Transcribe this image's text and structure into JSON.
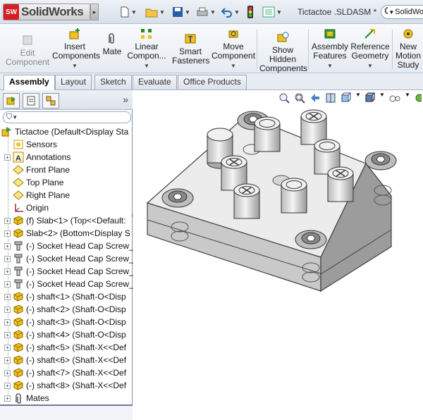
{
  "app": {
    "logo_text": "SolidWorks",
    "logo_badge": "SW",
    "doc_title": "Tictactoe .SLDASM *",
    "search_text": "SolidWo"
  },
  "commands": [
    {
      "label": "Edit Component",
      "disabled": true
    },
    {
      "label": "Insert Components"
    },
    {
      "label": "Mate"
    },
    {
      "label": "Linear Compon..."
    },
    {
      "label": "Smart Fasteners"
    },
    {
      "label": "Move Component"
    },
    {
      "label": "Show Hidden Components"
    },
    {
      "label": "Assembly Features"
    },
    {
      "label": "Reference Geometry"
    },
    {
      "label": "New Motion Study"
    }
  ],
  "tabs": [
    "Assembly",
    "Layout",
    "Sketch",
    "Evaluate",
    "Office Products"
  ],
  "tree": {
    "root": "Tictactoe  (Default<Display Sta",
    "items": [
      {
        "label": "Sensors",
        "icon": "sensor-icon",
        "expandable": false
      },
      {
        "label": "Annotations",
        "icon": "annotation-icon",
        "expandable": true
      },
      {
        "label": "Front Plane",
        "icon": "plane-icon",
        "expandable": false
      },
      {
        "label": "Top Plane",
        "icon": "plane-icon",
        "expandable": false
      },
      {
        "label": "Right Plane",
        "icon": "plane-icon",
        "expandable": false
      },
      {
        "label": "Origin",
        "icon": "origin-icon",
        "expandable": false
      },
      {
        "label": "(f) Slab<1> (Top<<Default:",
        "icon": "part-icon",
        "expandable": true
      },
      {
        "label": "Slab<2> (Bottom<Display S",
        "icon": "part-icon",
        "expandable": true
      },
      {
        "label": "(-) Socket Head Cap Screw_",
        "icon": "screw-icon",
        "expandable": true
      },
      {
        "label": "(-) Socket Head Cap Screw_",
        "icon": "screw-icon",
        "expandable": true
      },
      {
        "label": "(-) Socket Head Cap Screw_",
        "icon": "screw-icon",
        "expandable": true
      },
      {
        "label": "(-) Socket Head Cap Screw_",
        "icon": "screw-icon",
        "expandable": true
      },
      {
        "label": "(-) shaft<1> (Shaft-O<Disp",
        "icon": "part-icon",
        "expandable": true
      },
      {
        "label": "(-) shaft<2> (Shaft-O<Disp",
        "icon": "part-icon",
        "expandable": true
      },
      {
        "label": "(-) shaft<3> (Shaft-O<Disp",
        "icon": "part-icon",
        "expandable": true
      },
      {
        "label": "(-) shaft<4> (Shaft-O<Disp",
        "icon": "part-icon",
        "expandable": true
      },
      {
        "label": "(-) shaft<5> (Shaft-X<<Def",
        "icon": "part-icon",
        "expandable": true
      },
      {
        "label": "(-) shaft<6> (Shaft-X<<Def",
        "icon": "part-icon",
        "expandable": true
      },
      {
        "label": "(-) shaft<7> (Shaft-X<<Def",
        "icon": "part-icon",
        "expandable": true
      },
      {
        "label": "(-) shaft<8> (Shaft-X<<Def",
        "icon": "part-icon",
        "expandable": true
      },
      {
        "label": "Mates",
        "icon": "mates-icon",
        "expandable": true
      }
    ]
  },
  "colors": {
    "accent": "#d31f25",
    "part_yellow": "#f2c21b"
  }
}
